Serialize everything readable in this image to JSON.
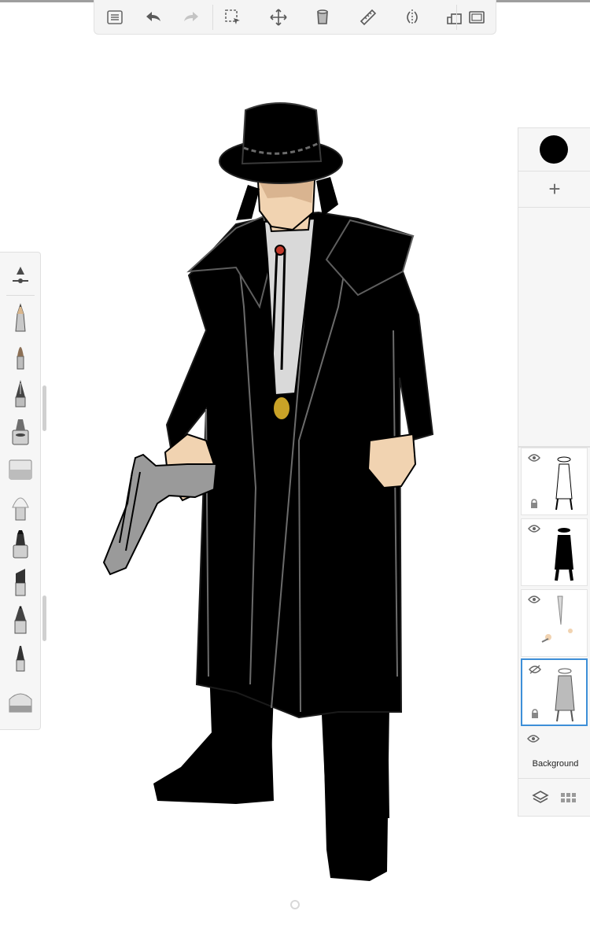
{
  "toolbar": {
    "tools": [
      {
        "name": "list-icon"
      },
      {
        "name": "undo-icon"
      },
      {
        "name": "redo-icon"
      },
      {
        "name": "selection-icon"
      },
      {
        "name": "transform-icon"
      },
      {
        "name": "fill-icon"
      },
      {
        "name": "ruler-icon"
      },
      {
        "name": "symmetry-icon"
      },
      {
        "name": "perspective-icon"
      },
      {
        "name": "fullscreen-icon"
      }
    ]
  },
  "brushes": [
    "size-slider-icon",
    "pencil-icon",
    "brush-icon",
    "ink-pen-icon",
    "airbrush-icon",
    "eraser-icon",
    "soft-brush-icon",
    "marker-icon",
    "chisel-marker-icon",
    "ballpoint-icon",
    "fine-pen-icon",
    "smudge-icon"
  ],
  "color_panel": {
    "current_color": "#000000",
    "add_label": "+"
  },
  "layers": {
    "items": [
      {
        "name": "layer-1",
        "visible": true,
        "locked": true
      },
      {
        "name": "layer-2",
        "visible": true,
        "locked": false
      },
      {
        "name": "layer-3",
        "visible": true,
        "locked": false
      },
      {
        "name": "layer-4",
        "visible": false,
        "locked": true,
        "active": true
      }
    ],
    "background_label": "Background"
  },
  "colors": {
    "accent": "#3d8fd8",
    "panel_bg": "#f6f6f6",
    "coat": "#000000",
    "skin": "#f1d3b1",
    "shirt": "#d9d9d9"
  }
}
